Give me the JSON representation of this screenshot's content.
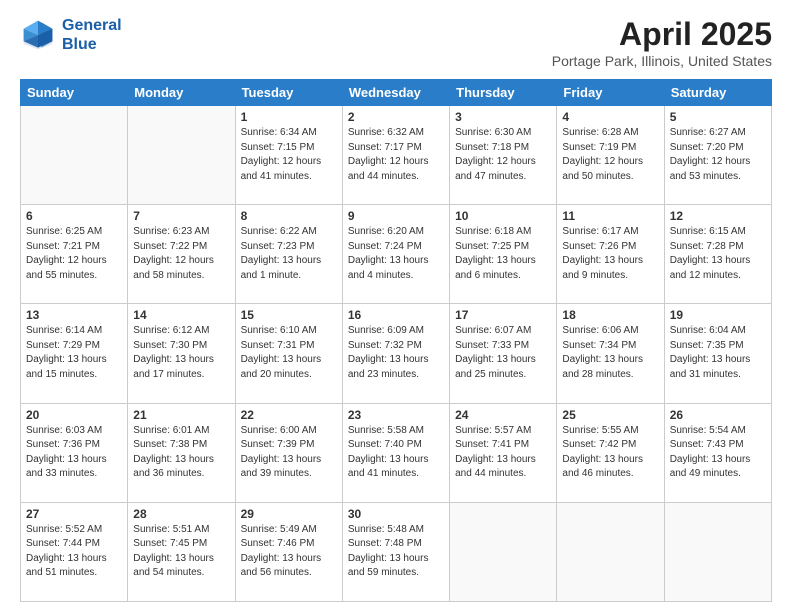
{
  "header": {
    "logo_line1": "General",
    "logo_line2": "Blue",
    "title": "April 2025",
    "subtitle": "Portage Park, Illinois, United States"
  },
  "days_of_week": [
    "Sunday",
    "Monday",
    "Tuesday",
    "Wednesday",
    "Thursday",
    "Friday",
    "Saturday"
  ],
  "weeks": [
    [
      {
        "day": "",
        "info": ""
      },
      {
        "day": "",
        "info": ""
      },
      {
        "day": "1",
        "info": "Sunrise: 6:34 AM\nSunset: 7:15 PM\nDaylight: 12 hours and 41 minutes."
      },
      {
        "day": "2",
        "info": "Sunrise: 6:32 AM\nSunset: 7:17 PM\nDaylight: 12 hours and 44 minutes."
      },
      {
        "day": "3",
        "info": "Sunrise: 6:30 AM\nSunset: 7:18 PM\nDaylight: 12 hours and 47 minutes."
      },
      {
        "day": "4",
        "info": "Sunrise: 6:28 AM\nSunset: 7:19 PM\nDaylight: 12 hours and 50 minutes."
      },
      {
        "day": "5",
        "info": "Sunrise: 6:27 AM\nSunset: 7:20 PM\nDaylight: 12 hours and 53 minutes."
      }
    ],
    [
      {
        "day": "6",
        "info": "Sunrise: 6:25 AM\nSunset: 7:21 PM\nDaylight: 12 hours and 55 minutes."
      },
      {
        "day": "7",
        "info": "Sunrise: 6:23 AM\nSunset: 7:22 PM\nDaylight: 12 hours and 58 minutes."
      },
      {
        "day": "8",
        "info": "Sunrise: 6:22 AM\nSunset: 7:23 PM\nDaylight: 13 hours and 1 minute."
      },
      {
        "day": "9",
        "info": "Sunrise: 6:20 AM\nSunset: 7:24 PM\nDaylight: 13 hours and 4 minutes."
      },
      {
        "day": "10",
        "info": "Sunrise: 6:18 AM\nSunset: 7:25 PM\nDaylight: 13 hours and 6 minutes."
      },
      {
        "day": "11",
        "info": "Sunrise: 6:17 AM\nSunset: 7:26 PM\nDaylight: 13 hours and 9 minutes."
      },
      {
        "day": "12",
        "info": "Sunrise: 6:15 AM\nSunset: 7:28 PM\nDaylight: 13 hours and 12 minutes."
      }
    ],
    [
      {
        "day": "13",
        "info": "Sunrise: 6:14 AM\nSunset: 7:29 PM\nDaylight: 13 hours and 15 minutes."
      },
      {
        "day": "14",
        "info": "Sunrise: 6:12 AM\nSunset: 7:30 PM\nDaylight: 13 hours and 17 minutes."
      },
      {
        "day": "15",
        "info": "Sunrise: 6:10 AM\nSunset: 7:31 PM\nDaylight: 13 hours and 20 minutes."
      },
      {
        "day": "16",
        "info": "Sunrise: 6:09 AM\nSunset: 7:32 PM\nDaylight: 13 hours and 23 minutes."
      },
      {
        "day": "17",
        "info": "Sunrise: 6:07 AM\nSunset: 7:33 PM\nDaylight: 13 hours and 25 minutes."
      },
      {
        "day": "18",
        "info": "Sunrise: 6:06 AM\nSunset: 7:34 PM\nDaylight: 13 hours and 28 minutes."
      },
      {
        "day": "19",
        "info": "Sunrise: 6:04 AM\nSunset: 7:35 PM\nDaylight: 13 hours and 31 minutes."
      }
    ],
    [
      {
        "day": "20",
        "info": "Sunrise: 6:03 AM\nSunset: 7:36 PM\nDaylight: 13 hours and 33 minutes."
      },
      {
        "day": "21",
        "info": "Sunrise: 6:01 AM\nSunset: 7:38 PM\nDaylight: 13 hours and 36 minutes."
      },
      {
        "day": "22",
        "info": "Sunrise: 6:00 AM\nSunset: 7:39 PM\nDaylight: 13 hours and 39 minutes."
      },
      {
        "day": "23",
        "info": "Sunrise: 5:58 AM\nSunset: 7:40 PM\nDaylight: 13 hours and 41 minutes."
      },
      {
        "day": "24",
        "info": "Sunrise: 5:57 AM\nSunset: 7:41 PM\nDaylight: 13 hours and 44 minutes."
      },
      {
        "day": "25",
        "info": "Sunrise: 5:55 AM\nSunset: 7:42 PM\nDaylight: 13 hours and 46 minutes."
      },
      {
        "day": "26",
        "info": "Sunrise: 5:54 AM\nSunset: 7:43 PM\nDaylight: 13 hours and 49 minutes."
      }
    ],
    [
      {
        "day": "27",
        "info": "Sunrise: 5:52 AM\nSunset: 7:44 PM\nDaylight: 13 hours and 51 minutes."
      },
      {
        "day": "28",
        "info": "Sunrise: 5:51 AM\nSunset: 7:45 PM\nDaylight: 13 hours and 54 minutes."
      },
      {
        "day": "29",
        "info": "Sunrise: 5:49 AM\nSunset: 7:46 PM\nDaylight: 13 hours and 56 minutes."
      },
      {
        "day": "30",
        "info": "Sunrise: 5:48 AM\nSunset: 7:48 PM\nDaylight: 13 hours and 59 minutes."
      },
      {
        "day": "",
        "info": ""
      },
      {
        "day": "",
        "info": ""
      },
      {
        "day": "",
        "info": ""
      }
    ]
  ]
}
